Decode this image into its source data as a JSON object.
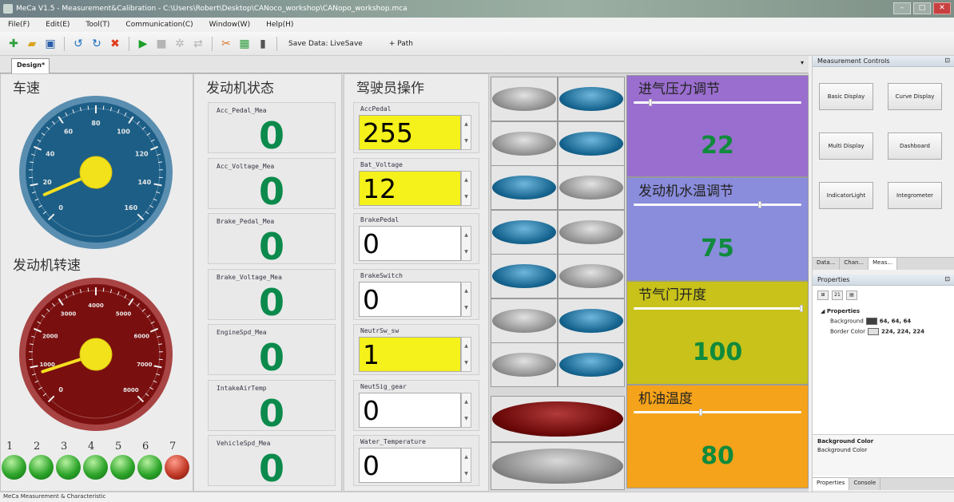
{
  "window": {
    "title": "MeCa V1.5 - Measurement&Calibration - C:\\Users\\Robert\\Desktop\\CANoco_workshop\\CANopo_workshop.mca",
    "minimize": "–",
    "maximize": "□",
    "close": "✕"
  },
  "menu": [
    "File(F)",
    "Edit(E)",
    "Tool(T)",
    "Communication(C)",
    "Window(W)",
    "Help(H)"
  ],
  "toolbar": {
    "icons": [
      {
        "name": "new-icon",
        "glyph": "✚",
        "color": "#2f9e3a"
      },
      {
        "name": "open-icon",
        "glyph": "▰",
        "color": "#d9a520"
      },
      {
        "name": "save-icon",
        "glyph": "▣",
        "color": "#2a5ea8"
      },
      {
        "name": "undo-icon",
        "glyph": "↺",
        "color": "#1c6fc0"
      },
      {
        "name": "redo-icon",
        "glyph": "↻",
        "color": "#1c6fc0"
      },
      {
        "name": "delete-icon",
        "glyph": "✖",
        "color": "#e03c1c"
      },
      {
        "name": "run-icon",
        "glyph": "▶",
        "color": "#1e9e2a"
      },
      {
        "name": "stop-icon",
        "glyph": "■",
        "color": "#b5b5b5"
      },
      {
        "name": "settings-icon",
        "glyph": "✲",
        "color": "#b5b5b5"
      },
      {
        "name": "connect-icon",
        "glyph": "⇄",
        "color": "#b5b5b5"
      },
      {
        "name": "tools-icon",
        "glyph": "✂",
        "color": "#d9772a"
      },
      {
        "name": "grid-icon",
        "glyph": "▦",
        "color": "#2e9e3e"
      },
      {
        "name": "database-icon",
        "glyph": "▮",
        "color": "#555555"
      }
    ],
    "save_data_label": "Save Data: LiveSave",
    "path_label": "+ Path"
  },
  "document_tab": "Design*",
  "tab_dropdown": "▾",
  "panels": {
    "speed_title": "车速",
    "rpm_title": "发动机转速",
    "engine_state_title": "发动机状态",
    "driver_title": "驾驶员操作"
  },
  "speed_gauge": {
    "ticks": [
      "0",
      "20",
      "40",
      "60",
      "80",
      "100",
      "120",
      "140",
      "160"
    ],
    "value_fraction": 0.08,
    "face_color": "#1c5e86",
    "rim_color": "#5a8eb0"
  },
  "rpm_gauge": {
    "ticks": [
      "0",
      "1000",
      "2000",
      "3000",
      "4000",
      "5000",
      "6000",
      "7000",
      "8000"
    ],
    "value_fraction": 0.1,
    "face_color": "#7a0f0f",
    "rim_color": "#a84444"
  },
  "engine_state": [
    {
      "label": "Acc_Pedal_Mea",
      "value": "0"
    },
    {
      "label": "Acc_Voltage_Mea",
      "value": "0"
    },
    {
      "label": "Brake_Pedal_Mea",
      "value": "0"
    },
    {
      "label": "Brake_Voltage_Mea",
      "value": "0"
    },
    {
      "label": "EngineSpd_Mea",
      "value": "0"
    },
    {
      "label": "IntakeAirTemp",
      "value": "0"
    },
    {
      "label": "VehicleSpd_Mea",
      "value": "0"
    }
  ],
  "driver_inputs": [
    {
      "label": "AccPedal",
      "value": "255",
      "highlight": true
    },
    {
      "label": "Bat_Voltage",
      "value": "12",
      "highlight": true
    },
    {
      "label": "BrakePedal",
      "value": "0",
      "highlight": false
    },
    {
      "label": "BrakeSwitch",
      "value": "0",
      "highlight": false
    },
    {
      "label": "NeutrSw_sw",
      "value": "1",
      "highlight": true
    },
    {
      "label": "NeutSig_gear",
      "value": "0",
      "highlight": false
    },
    {
      "label": "Water_Temperature",
      "value": "0",
      "highlight": false
    }
  ],
  "spinner": {
    "up": "▲",
    "down": "▼"
  },
  "switch_buttons": [
    [
      "g",
      "b"
    ],
    [
      "g",
      "b"
    ],
    [
      "b",
      "g"
    ],
    [
      "b",
      "g"
    ],
    [
      "b",
      "g"
    ],
    [
      "g",
      "b"
    ],
    [
      "g",
      "b"
    ]
  ],
  "big_buttons": [
    {
      "color": "red"
    },
    {
      "color": "grey"
    }
  ],
  "sliders": [
    {
      "title": "进气压力调节",
      "value": "22",
      "fraction": 0.1,
      "bg": "#9a6ecf"
    },
    {
      "title": "发动机水温调节",
      "value": "75",
      "fraction": 0.75,
      "bg": "#8a8cdc"
    },
    {
      "title": "节气门开度",
      "value": "100",
      "fraction": 1.0,
      "bg": "#c8c21a"
    },
    {
      "title": "机油温度",
      "value": "80",
      "fraction": 0.4,
      "bg": "#f5a31a"
    }
  ],
  "leds": [
    {
      "n": "1",
      "on": true
    },
    {
      "n": "2",
      "on": true
    },
    {
      "n": "3",
      "on": true
    },
    {
      "n": "4",
      "on": true
    },
    {
      "n": "5",
      "on": true
    },
    {
      "n": "6",
      "on": true
    },
    {
      "n": "7",
      "on": false
    }
  ],
  "right_pane": {
    "controls_header": "Measurement Controls",
    "pin": "⊡",
    "buttons": [
      "Basic Display",
      "Curve Display",
      "Multi Display",
      "Dashboard",
      "IndicatorLight",
      "Integrometer"
    ],
    "mid_tabs": [
      "Data...",
      "Chan...",
      "Meas..."
    ],
    "properties_header": "Properties",
    "sort_icons": [
      "⊞",
      "21",
      "▤"
    ],
    "group": "Properties",
    "rows": [
      {
        "name": "Background",
        "value": "64, 64, 64",
        "color": "#404040"
      },
      {
        "name": "Border Color",
        "value": "224, 224, 224",
        "color": "#e0e0e0"
      }
    ],
    "desc_title": "Background Color",
    "desc_text": "Background Color",
    "bottom_tabs": [
      "Properties",
      "Console"
    ]
  },
  "status_text": "MeCa Measurement & Characteristic"
}
